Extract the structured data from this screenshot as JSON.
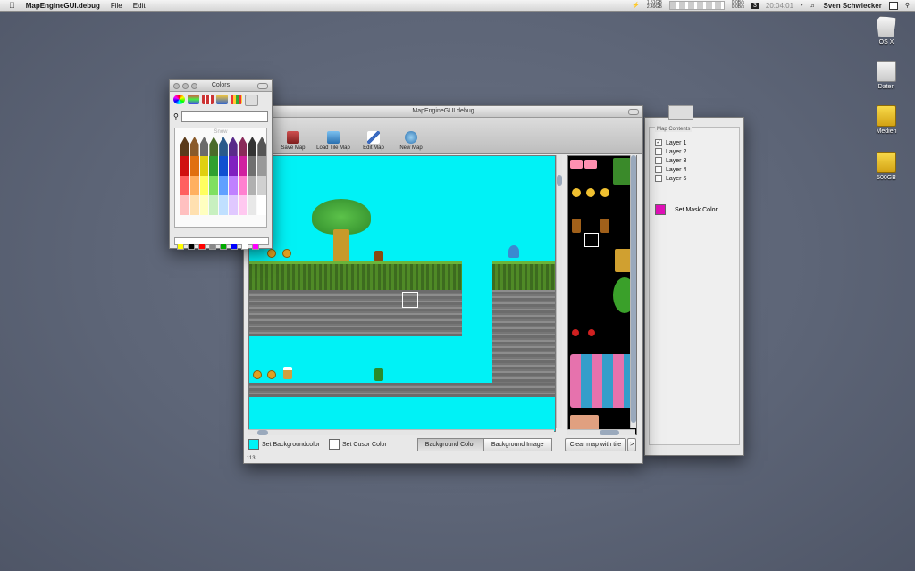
{
  "menubar": {
    "apple": "",
    "app_name": "MapEngineGUI.debug",
    "menus": [
      "File",
      "Edit"
    ],
    "status": {
      "mem1_top": "1.51GB",
      "mem1_bot": "2.49GB",
      "net_top": "0.0B/s",
      "net_bot": "0.0B/s",
      "date_badge": "3",
      "clock": "20:04:01",
      "user": "Sven Schwiecker"
    }
  },
  "desktop": {
    "icons": [
      {
        "label": "OS X",
        "icon": "trash-drive-icon"
      },
      {
        "label": "Daten",
        "icon": "white-drive-icon"
      },
      {
        "label": "Medien",
        "icon": "yellow-drive-icon"
      },
      {
        "label": "500GB",
        "icon": "yellow-drive-icon"
      }
    ]
  },
  "colors_window": {
    "title": "Colors",
    "palette_name": "Snow",
    "search_value": "",
    "crayon_colors_row1": [
      "#5a3a1a",
      "#8a5a2a",
      "#6b6b6b",
      "#4a6b2a",
      "#2a5a8a",
      "#5a2a8a",
      "#8a2a5a",
      "#333333",
      "#555555"
    ],
    "crayon_colors_row2": [
      "#d01010",
      "#e07010",
      "#e0d010",
      "#30a030",
      "#1050d0",
      "#8020c0",
      "#d020a0",
      "#707070",
      "#999999"
    ],
    "crayon_colors_row3": [
      "#ff6060",
      "#ffb060",
      "#ffff60",
      "#80e060",
      "#60a0ff",
      "#c080ff",
      "#ff80d0",
      "#b0b0b0",
      "#d0d0d0"
    ],
    "crayon_colors_row4": [
      "#ffc0c0",
      "#ffe0b0",
      "#ffffc0",
      "#c8f0c0",
      "#c0e0ff",
      "#e0c8ff",
      "#ffc8f0",
      "#e8e8e8",
      "#ffffff"
    ],
    "well_colors": [
      "#ffff00",
      "#000000",
      "#ff0000",
      "#888888",
      "#00aa00",
      "#0000ff",
      "#ffffff",
      "#ff00ff"
    ]
  },
  "main_window": {
    "title": "MapEngineGUI.debug",
    "toolbar": [
      {
        "label": "Save Map",
        "icon": "save-map-icon",
        "color": "#b03030"
      },
      {
        "label": "Load Tile Map",
        "icon": "load-tile-map-icon",
        "color": "#3a8ad0"
      },
      {
        "label": "Edit Map",
        "icon": "edit-map-icon",
        "color": "#3a6ac0"
      },
      {
        "label": "New Map",
        "icon": "new-map-icon",
        "color": "#4a9ad0"
      }
    ],
    "map_background": "#00f2f6",
    "bottom": {
      "set_background_label": "Set Backgroundcolor",
      "background_swatch": "#00f2f6",
      "set_cursor_label": "Set Cusor Color",
      "cursor_swatch": "#ffffff",
      "segment_bg_color": "Background Color",
      "segment_bg_image": "Background Image",
      "clear_button": "Clear map with tile",
      "arrow_button": ">"
    },
    "status_number": "113"
  },
  "contents_window": {
    "group_title": "Map Contents",
    "layers": [
      {
        "label": "Layer 1",
        "checked": true
      },
      {
        "label": "Layer 2",
        "checked": false
      },
      {
        "label": "Layer 3",
        "checked": false
      },
      {
        "label": "Layer 4",
        "checked": false
      },
      {
        "label": "Layer 5",
        "checked": false
      }
    ],
    "mask_label": "Set Mask Color",
    "mask_color": "#e010b8"
  }
}
